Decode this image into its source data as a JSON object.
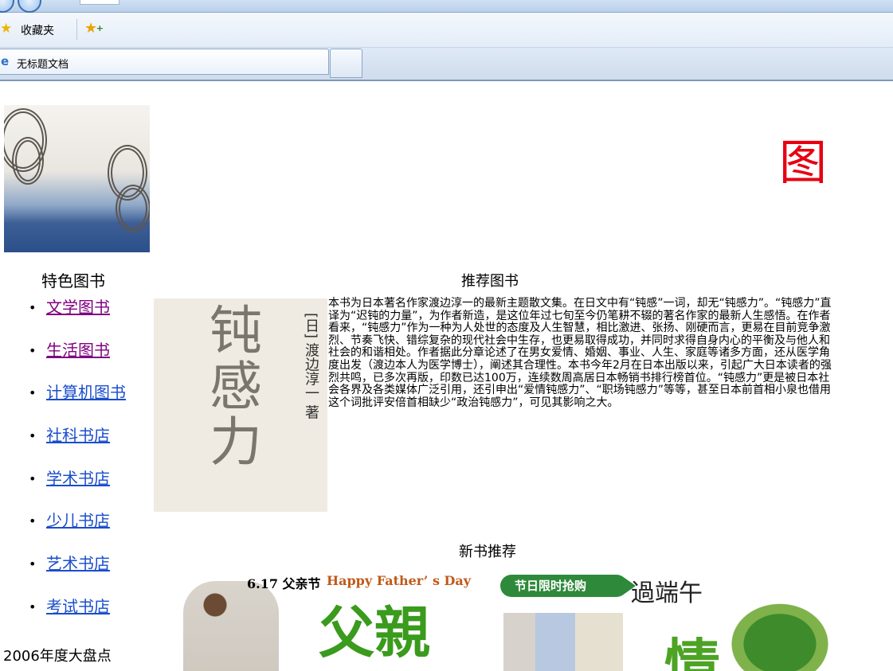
{
  "browser": {
    "favorites_label": "收藏夹",
    "tab_title": "无标题文档"
  },
  "banner": {
    "char": "图"
  },
  "sidebar": {
    "title": "特色图书",
    "items": [
      {
        "label": "文学图书",
        "visited": true
      },
      {
        "label": "生活图书",
        "visited": true
      },
      {
        "label": "计算机图书",
        "visited": false
      },
      {
        "label": "社科书店",
        "visited": false
      },
      {
        "label": "学术书店",
        "visited": false
      },
      {
        "label": "少儿书店",
        "visited": false
      },
      {
        "label": "艺术书店",
        "visited": false
      },
      {
        "label": "考试书店",
        "visited": false
      }
    ],
    "year_summary": "2006年度大盘点"
  },
  "recommend": {
    "title": "推荐图书",
    "cover": {
      "title_chars": [
        "钝",
        "感",
        "力"
      ],
      "author": "[日] 渡边淳一 著"
    },
    "description": "本书为日本著名作家渡边淳一的最新主题散文集。在日文中有“钝感”一词，却无“钝感力”。“钝感力”直译为“迟钝的力量”，为作者新造，是这位年过七旬至今仍笔耕不辍的著名作家的最新人生感悟。在作者看来，“钝感力”作为一种为人处世的态度及人生智慧，相比激进、张扬、刚硬而言，更易在目前竞争激烈、节奏飞快、错综复杂的现代社会中生存，也更易取得成功，并同时求得自身内心的平衡及与他人和社会的和谐相处。作者据此分章论述了在男女爱情、婚姻、事业、人生、家庭等诸多方面，还从医学角度出发（渡边本人为医学博士），阐述其合理性。本书今年2月在日本出版以来，引起广大日本读者的强烈共鸣，已多次再版，印数已达100万，连续数周高居日本畅销书排行榜首位。“钝感力”更是被日本社会各界及各类媒体广泛引用，还引申出“爱情钝感力”、“职场钝感力”等等，甚至日本前首相小泉也借用这个词批评安倍首相缺少“政治钝感力”，可见其影响之大。"
  },
  "new_books": {
    "title": "新书推荐",
    "ad1": {
      "date": "6.17 父亲节",
      "tagline": "Happy Father’ s Day",
      "kanji": "父親"
    },
    "ad2": {
      "badge": "节日限时抢购",
      "headline": "過端午",
      "kanji": "情"
    }
  }
}
